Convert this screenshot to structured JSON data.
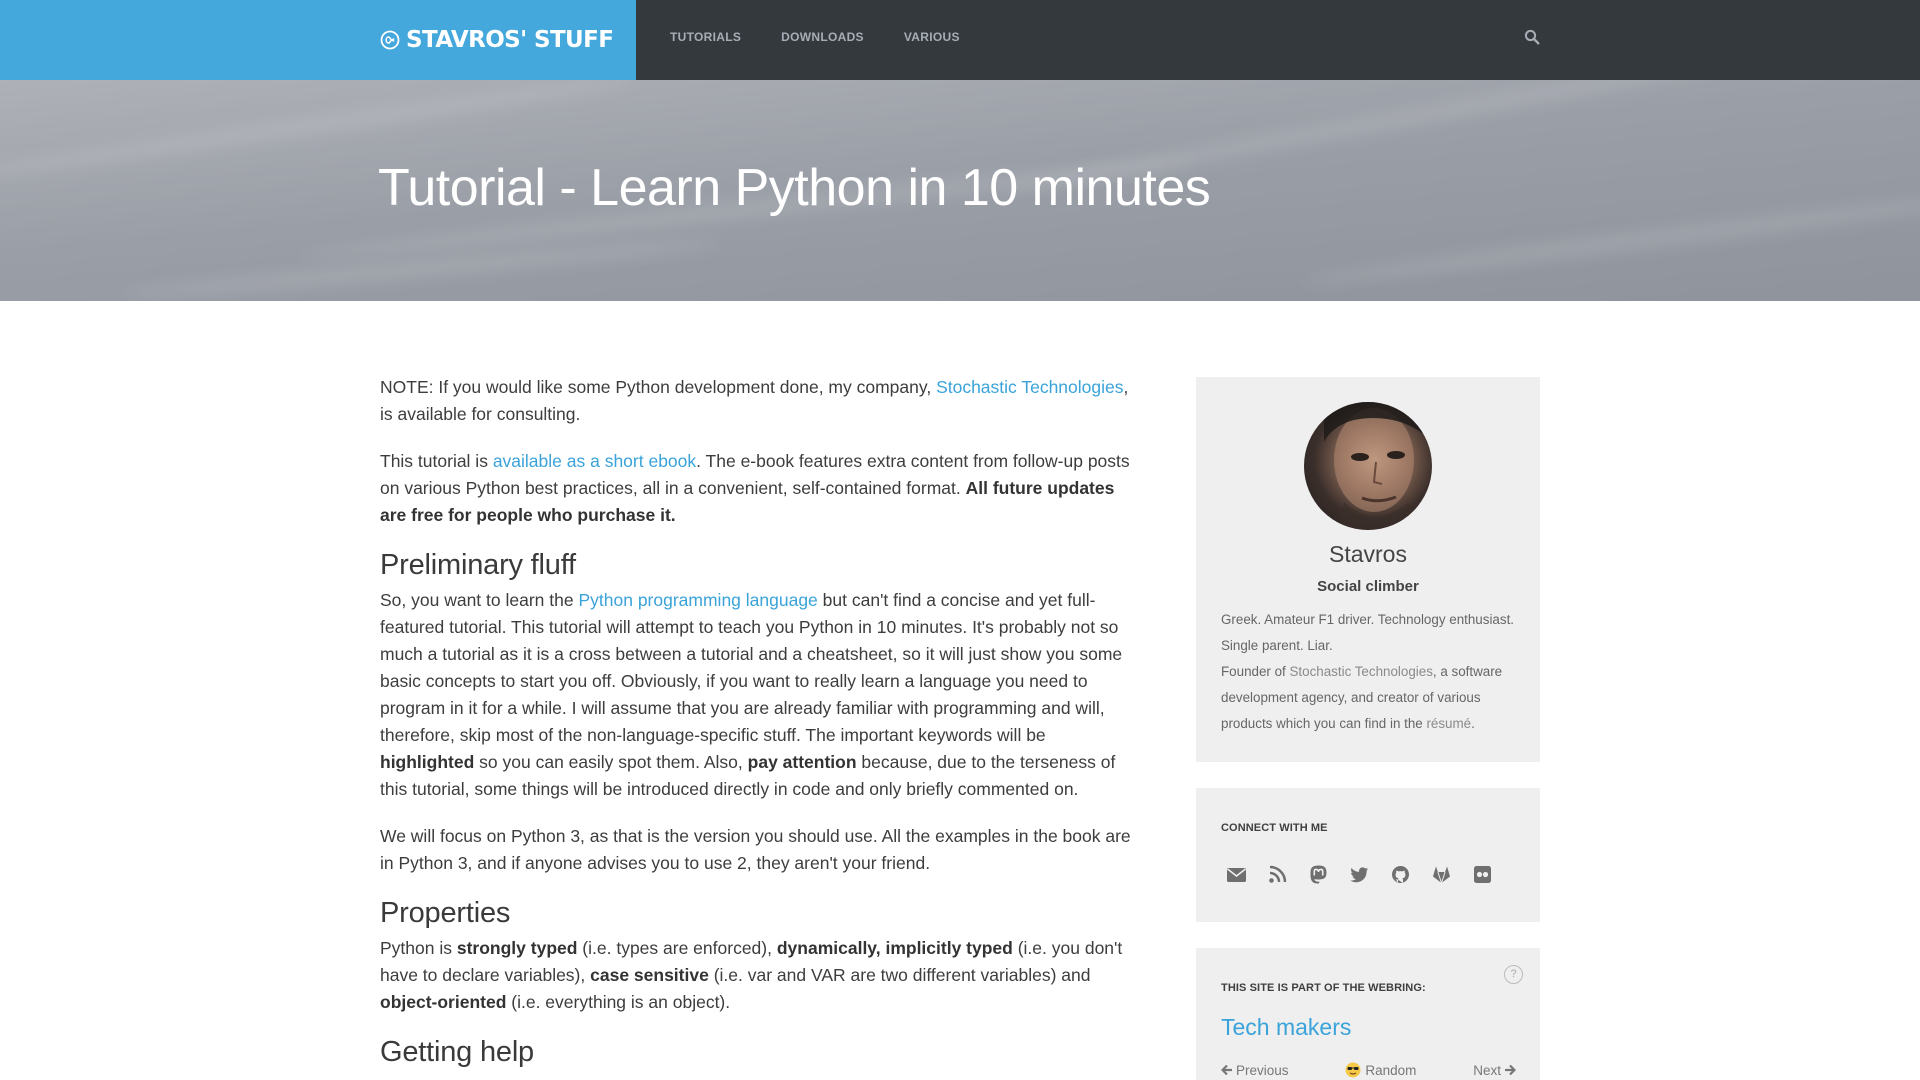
{
  "header": {
    "brand": "STAVROS' STUFF",
    "nav": [
      "TUTORIALS",
      "DOWNLOADS",
      "VARIOUS"
    ],
    "colors": {
      "bar": "#34393e",
      "brand_block": "#44a8dc"
    }
  },
  "hero": {
    "title": "Tutorial - Learn Python in 10 minutes"
  },
  "article": {
    "note": {
      "before": "NOTE: If you would like some Python development done, my company, ",
      "link": "Stochastic Technologies",
      "after": ", is available for consulting."
    },
    "ebook": {
      "before": "This tutorial is ",
      "link": "available as a short ebook",
      "middle": ". The e-book features extra content from follow-up posts on various Python best practices, all in a convenient, self-contained format. ",
      "bold": "All future updates are free for people who purchase it."
    },
    "h_fluff": "Preliminary fluff",
    "fluff": {
      "p1": "So, you want to learn the ",
      "link": "Python programming language",
      "p2": " but can't find a concise and yet full-featured tutorial. This tutorial will attempt to teach you Python in 10 minutes. It's probably not so much a tutorial as it is a cross between a tutorial and a cheatsheet, so it will just show you some basic concepts to start you off. Obviously, if you want to really learn a language you need to program in it for a while. I will assume that you are already familiar with programming and will, therefore, skip most of the non-language-specific stuff. The important keywords will be ",
      "b1": "highlighted",
      "p3": " so you can easily spot them. Also, ",
      "b2": "pay attention",
      "p4": " because, due to the terseness of this tutorial, some things will be introduced directly in code and only briefly commented on."
    },
    "focus": "We will focus on Python 3, as that is the version you should use. All the examples in the book are in Python 3, and if anyone advises you to use 2, they aren't your friend.",
    "h_props": "Properties",
    "props": {
      "p1": "Python is ",
      "b1": "strongly typed",
      "p2": " (i.e. types are enforced), ",
      "b2": "dynamically, implicitly typed",
      "p3": " (i.e. you don't have to declare variables), ",
      "b3": "case sensitive",
      "p4": " (i.e. var and VAR are two different variables) and ",
      "b4": "object-oriented",
      "p5": " (i.e. everything is an object)."
    },
    "h_help": "Getting help",
    "link_color": "#3aa3d9"
  },
  "sidebar": {
    "profile": {
      "name": "Stavros",
      "role": "Social climber",
      "bio1": "Greek. Amateur F1 driver. Technology enthusiast. Single parent. Liar.",
      "bio2_before": "Founder of ",
      "bio2_link": "Stochastic Technologies",
      "bio2_after": ", a software development agency, and creator of various products which you can find in the ",
      "bio2_link2": "résumé",
      "bio2_end": "."
    },
    "connect": {
      "heading": "CONNECT WITH ME",
      "icons": [
        "email-icon",
        "rss-icon",
        "mastodon-icon",
        "twitter-icon",
        "github-icon",
        "gitlab-icon",
        "flickr-icon"
      ]
    },
    "webring": {
      "heading": "THIS SITE IS PART OF THE WEBRING:",
      "help": "?",
      "title": "Tech makers",
      "previous": "Previous",
      "random": "Random",
      "next": "Next"
    }
  }
}
